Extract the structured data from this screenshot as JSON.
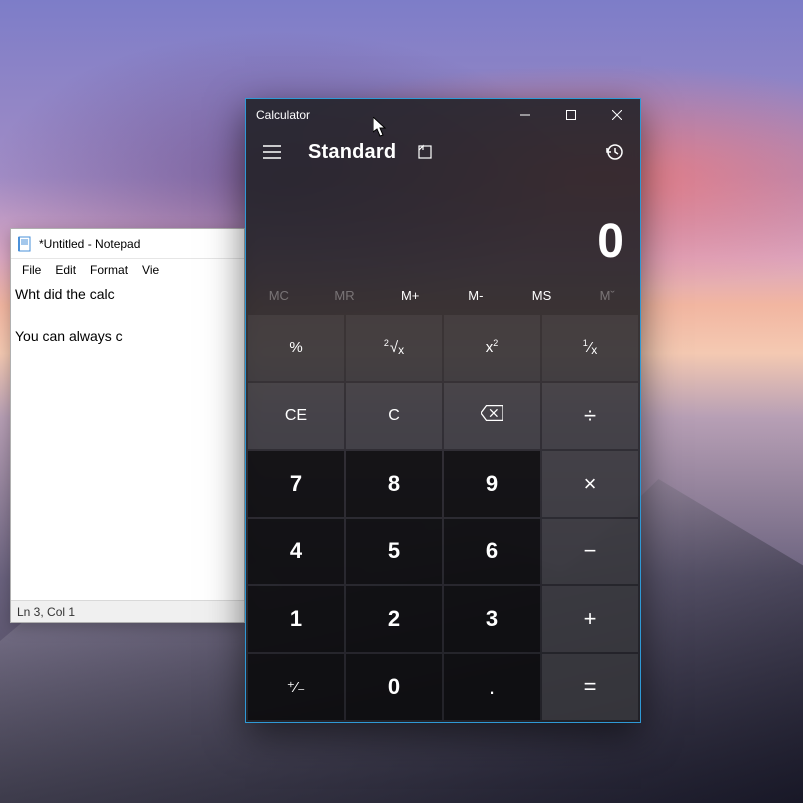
{
  "notepad": {
    "title": "*Untitled - Notepad",
    "menu": {
      "file": "File",
      "edit": "Edit",
      "format": "Format",
      "view": "Vie"
    },
    "body_line1": "Wht did the calc",
    "body_line2": "",
    "body_line3": "You can always c",
    "statusbar": "Ln 3, Col 1"
  },
  "calculator": {
    "title": "Calculator",
    "mode": "Standard",
    "display": "0",
    "memory": {
      "mc": "MC",
      "mr": "MR",
      "mplus": "M+",
      "mminus": "M-",
      "ms": "MS",
      "mlist": "Mˇ"
    },
    "keys": {
      "percent": "%",
      "root_pre": "2",
      "root_sym": "√",
      "root_var": "x",
      "square_base": "x",
      "square_exp": "2",
      "recip_num": "1",
      "recip_slash": "⁄",
      "recip_den": "x",
      "ce": "CE",
      "c": "C",
      "divide": "÷",
      "multiply": "×",
      "minus": "−",
      "plus": "+",
      "equals": "=",
      "d7": "7",
      "d8": "8",
      "d9": "9",
      "d4": "4",
      "d5": "5",
      "d6": "6",
      "d1": "1",
      "d2": "2",
      "d3": "3",
      "d0": "0",
      "sign": "⁺⁄₋",
      "dot": "."
    }
  }
}
